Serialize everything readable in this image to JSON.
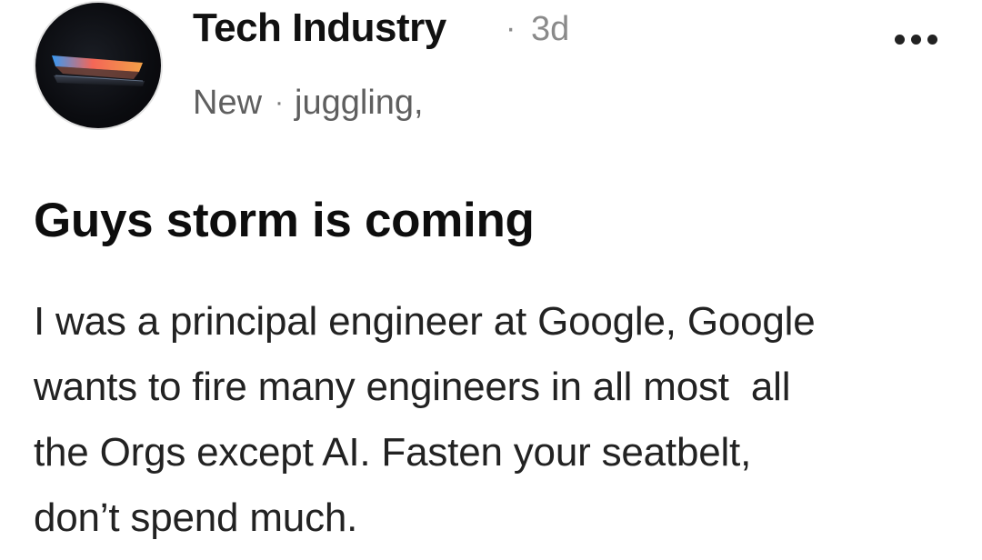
{
  "post": {
    "community": "Tech Industry",
    "separator": "·",
    "age": "3d",
    "status": "New",
    "tag": "juggling,",
    "title": "Guys storm is coming",
    "body": "I was a principal engineer at Google, Google\nwants to fire many engineers in all most  all\nthe Orgs except AI. Fasten your seatbelt,\ndon’t spend much."
  },
  "icons": {
    "avatar": "laptop-glow-image",
    "more": "more-horizontal-icon"
  },
  "colors": {
    "primary_text": "#111111",
    "secondary_text": "#5f5f5f",
    "muted_text": "#8a8a8a"
  }
}
